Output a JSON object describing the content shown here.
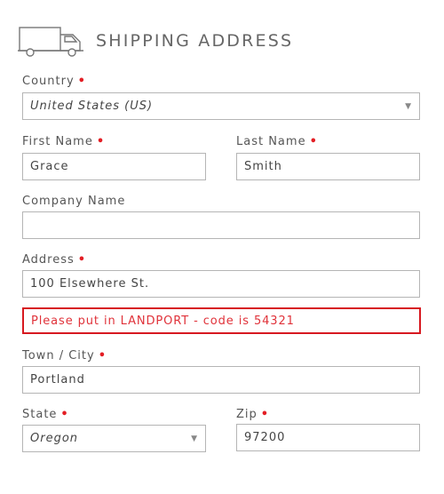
{
  "section": {
    "title": "SHIPPING ADDRESS",
    "icon": "delivery-truck-icon"
  },
  "required_marker": "•",
  "colors": {
    "required": "#e31e24",
    "notice_border": "#d71920",
    "notice_text": "#e0323a",
    "field_border": "#b5b5b5"
  },
  "fields": {
    "country": {
      "label": "Country",
      "value": "United States (US)"
    },
    "first_name": {
      "label": "First Name",
      "value": "Grace"
    },
    "last_name": {
      "label": "Last Name",
      "value": "Smith"
    },
    "company": {
      "label": "Company Name",
      "value": ""
    },
    "address": {
      "label": "Address",
      "value": "100 Elsewhere St."
    },
    "address2": {
      "value": "Please put in LANDPORT - code is 54321"
    },
    "city": {
      "label": "Town / City",
      "value": "Portland"
    },
    "state": {
      "label": "State",
      "value": "Oregon"
    },
    "zip": {
      "label": "Zip",
      "value": "97200"
    }
  }
}
